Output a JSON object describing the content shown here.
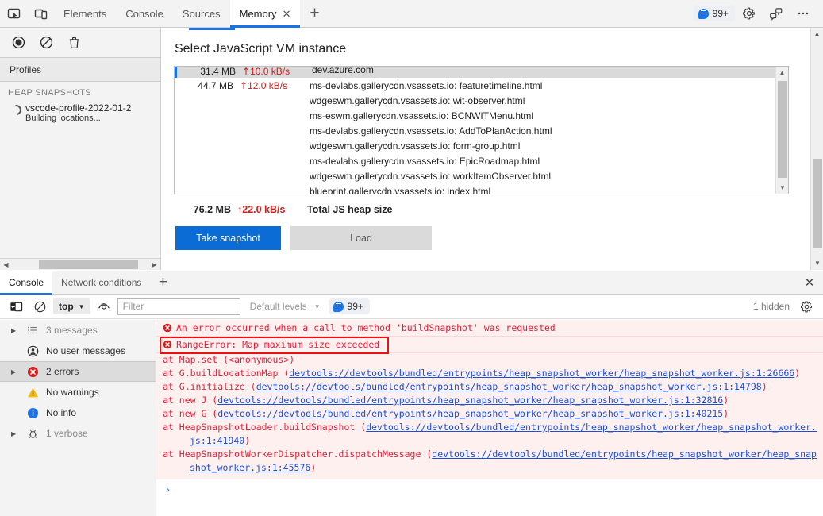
{
  "toolbar": {
    "icons": [
      {
        "name": "inspect-element-icon"
      },
      {
        "name": "device-toolbar-icon"
      }
    ],
    "tabs": [
      {
        "label": "Elements",
        "active": false,
        "closable": false
      },
      {
        "label": "Console",
        "active": false,
        "closable": false
      },
      {
        "label": "Sources",
        "active": false,
        "closable": false
      },
      {
        "label": "Memory",
        "active": true,
        "closable": true
      }
    ],
    "add_tab_label": "+",
    "close_glyph": "✕",
    "issues_badge": "99+",
    "settings_icon": "gear-icon",
    "feedback_icon": "feedback-icon",
    "more_icon": "more-options-icon"
  },
  "memory_panel": {
    "sidebar": {
      "record_icon": "record-icon",
      "clear_icon": "clear-icon",
      "delete_icon": "trash-icon",
      "profiles_label": "Profiles",
      "section_label": "HEAP SNAPSHOTS",
      "snapshot": {
        "name": "vscode-profile-2022-01-2",
        "status": "Building locations..."
      }
    },
    "title": "Select JavaScript VM instance",
    "vm_rows": [
      {
        "size": "31.4 MB",
        "rate": "10.0 kB/s",
        "rate_arrow": "↑",
        "urls": [
          "dev.azure.com"
        ],
        "selected": true,
        "clipped": true
      },
      {
        "size": "44.7 MB",
        "rate": "12.0 kB/s",
        "rate_arrow": "↑",
        "urls": [
          "ms-devlabs.gallerycdn.vsassets.io: featuretimeline.html",
          "wdgeswm.gallerycdn.vsassets.io: wit-observer.html",
          "ms-eswm.gallerycdn.vsassets.io: BCNWITMenu.html",
          "ms-devlabs.gallerycdn.vsassets.io: AddToPlanAction.html",
          "wdgeswm.gallerycdn.vsassets.io: form-group.html",
          "ms-devlabs.gallerycdn.vsassets.io: EpicRoadmap.html",
          "wdgeswm.gallerycdn.vsassets.io: workItemObserver.html",
          "blueprint.gallerycdn.vsassets.io: index.html"
        ],
        "selected": false,
        "clipped": false
      }
    ],
    "heap_total": {
      "size": "76.2 MB",
      "rate": "22.0 kB/s",
      "rate_arrow": "↑",
      "label": "Total JS heap size"
    },
    "take_snapshot_label": "Take snapshot",
    "load_label": "Load"
  },
  "drawer": {
    "tabs": [
      {
        "label": "Console",
        "active": true
      },
      {
        "label": "Network conditions",
        "active": false
      }
    ],
    "add_tab_label": "+",
    "close_glyph": "✕",
    "console_toolbar": {
      "sidebar_toggle_icon": "console-sidebar-toggle-icon",
      "clear_icon": "clear-console-icon",
      "context_value": "top",
      "live_expression_icon": "eye-icon",
      "filter_placeholder": "Filter",
      "filter_value": "",
      "levels_label": "Default levels",
      "issues_badge": "99+",
      "hidden_label": "1 hidden",
      "settings_icon": "gear-icon"
    },
    "sidebar_items": [
      {
        "label": "3 messages",
        "icon": "list-icon",
        "expandable": true,
        "selected": false,
        "muted": true
      },
      {
        "label": "No user messages",
        "icon": "user-icon",
        "expandable": false,
        "selected": false,
        "muted": false
      },
      {
        "label": "2 errors",
        "icon": "error-icon",
        "expandable": true,
        "selected": true,
        "muted": false
      },
      {
        "label": "No warnings",
        "icon": "warning-icon",
        "expandable": false,
        "selected": false,
        "muted": false
      },
      {
        "label": "No info",
        "icon": "info-icon",
        "expandable": false,
        "selected": false,
        "muted": false
      },
      {
        "label": "1 verbose",
        "icon": "bug-icon",
        "expandable": true,
        "selected": false,
        "muted": true
      }
    ],
    "messages": [
      {
        "text": "An error occurred when a call to method 'buildSnapshot' was requested",
        "level": "error",
        "highlighted": false
      },
      {
        "text": "RangeError: Map maximum size exceeded",
        "level": "error",
        "highlighted": true
      }
    ],
    "stack_frames": [
      {
        "prefix": "    at Map.set (<anonymous>)",
        "link": "",
        "suffix": ""
      },
      {
        "prefix": "    at G.buildLocationMap (",
        "link": "devtools://devtools/bundled/entrypoints/heap_snapshot_worker/heap_snapshot_worker.js:1:26666",
        "suffix": ")"
      },
      {
        "prefix": "    at G.initialize (",
        "link": "devtools://devtools/bundled/entrypoints/heap_snapshot_worker/heap_snapshot_worker.js:1:14798",
        "suffix": ")"
      },
      {
        "prefix": "    at new J (",
        "link": "devtools://devtools/bundled/entrypoints/heap_snapshot_worker/heap_snapshot_worker.js:1:32816",
        "suffix": ")"
      },
      {
        "prefix": "    at new G (",
        "link": "devtools://devtools/bundled/entrypoints/heap_snapshot_worker/heap_snapshot_worker.js:1:40215",
        "suffix": ")"
      },
      {
        "prefix": "    at HeapSnapshotLoader.buildSnapshot (",
        "link": "devtools://devtools/bundled/entrypoints/heap_snapshot_worker/heap_snapshot_worker.js:1:41940",
        "suffix": ")"
      },
      {
        "prefix": "    at HeapSnapshotWorkerDispatcher.dispatchMessage (",
        "link": "devtools://devtools/bundled/entrypoints/heap_snapshot_worker/heap_snapshot_worker.js:1:45576",
        "suffix": ")"
      }
    ],
    "prompt_glyph": "›"
  },
  "colors": {
    "accent": "#1a73e8",
    "error": "#e0213a",
    "rate": "#c5221f",
    "link": "#1a4fd6",
    "highlight_box": "#ee1111",
    "button_primary": "#0a6cd4"
  }
}
